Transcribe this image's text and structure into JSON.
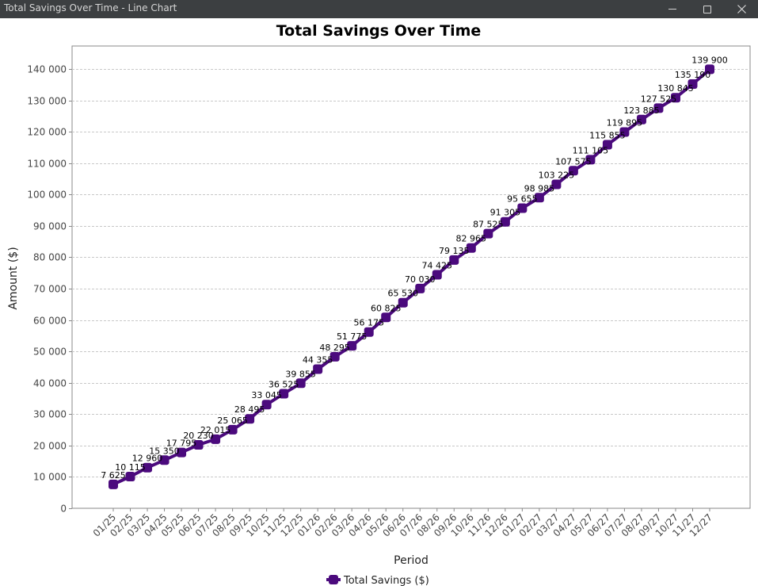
{
  "window": {
    "title": "Total Savings Over Time - Line Chart",
    "controls": [
      "minimize",
      "maximize",
      "close"
    ]
  },
  "chart_data": {
    "type": "line",
    "title": "Total Savings Over Time",
    "xlabel": "Period",
    "ylabel": "Amount ($)",
    "ylim": [
      0,
      145000
    ],
    "yticks": [
      0,
      10000,
      20000,
      30000,
      40000,
      50000,
      60000,
      70000,
      80000,
      90000,
      100000,
      110000,
      120000,
      130000,
      140000
    ],
    "ytick_labels": [
      "0",
      "10 000",
      "20 000",
      "30 000",
      "40 000",
      "50 000",
      "60 000",
      "70 000",
      "80 000",
      "90 000",
      "100 000",
      "110 000",
      "120 000",
      "130 000",
      "140 000"
    ],
    "grid": true,
    "legend_position": "bottom",
    "categories": [
      "01/25",
      "02/25",
      "03/25",
      "04/25",
      "05/25",
      "06/25",
      "07/25",
      "08/25",
      "09/25",
      "10/25",
      "11/25",
      "12/25",
      "01/26",
      "02/26",
      "03/26",
      "04/26",
      "05/26",
      "06/26",
      "07/26",
      "08/26",
      "09/26",
      "10/26",
      "11/26",
      "12/26",
      "01/27",
      "02/27",
      "03/27",
      "04/27",
      "05/27",
      "06/27",
      "07/27",
      "08/27",
      "09/27",
      "10/27",
      "11/27",
      "12/27"
    ],
    "series": [
      {
        "name": "Total Savings ($)",
        "color": "#4b0a7d",
        "values": [
          7625,
          10115,
          12960,
          15350,
          17795,
          20230,
          22015,
          25065,
          28495,
          33045,
          36525,
          39855,
          44355,
          48295,
          51775,
          56175,
          60825,
          65530,
          70030,
          74425,
          79135,
          82965,
          87525,
          91305,
          95655,
          98985,
          103225,
          107575,
          111105,
          115855,
          119895,
          123885,
          127525,
          130845,
          135190,
          139900
        ],
        "labels": [
          "7 625",
          "10 115",
          "12 960",
          "15 350",
          "17 795",
          "20 230",
          "22 015",
          "25 065",
          "28 495",
          "33 045",
          "36 525",
          "39 855",
          "44 355",
          "48 295",
          "51 775",
          "56 175",
          "60 825",
          "65 530",
          "70 030",
          "74 425",
          "79 135",
          "82 965",
          "87 525",
          "91 305",
          "95 655",
          "98 985",
          "103 225",
          "107 575",
          "111 105",
          "115 855",
          "119 895",
          "123 885",
          "127 525",
          "130 845",
          "135 190",
          "139 900"
        ]
      }
    ]
  }
}
